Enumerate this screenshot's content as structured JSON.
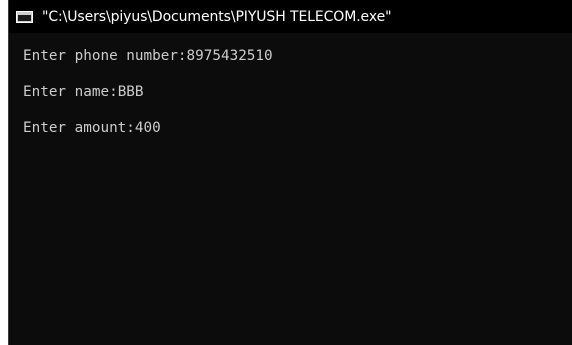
{
  "window": {
    "title": "\"C:\\Users\\piyus\\Documents\\PIYUSH TELECOM.exe\""
  },
  "console": {
    "lines": [
      {
        "prompt": "Enter phone number:",
        "value": "8975432510"
      },
      {
        "prompt": "Enter name:",
        "value": "BBB"
      },
      {
        "prompt": "Enter amount:",
        "value": "400"
      }
    ]
  },
  "colors": {
    "background": "#0c0c0c",
    "titlebar": "#000000",
    "text": "#cccccc"
  }
}
